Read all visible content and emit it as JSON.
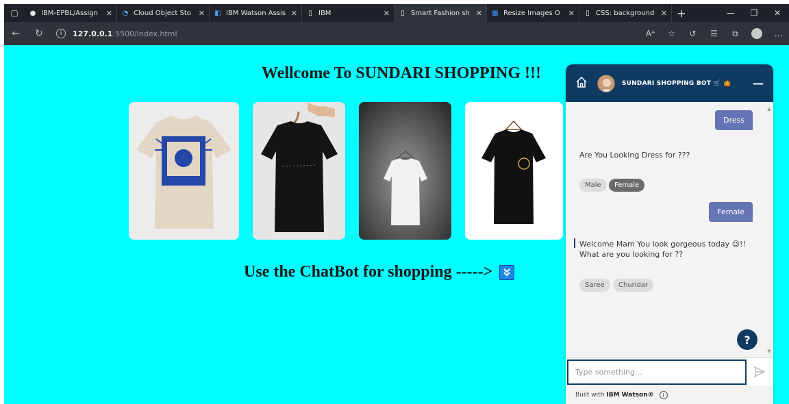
{
  "browser": {
    "tabs": [
      {
        "label": "IBM-EPBL/Assign",
        "icon": "github-icon"
      },
      {
        "label": "Cloud Object Sto",
        "icon": "cloud-icon"
      },
      {
        "label": "IBM Watson Assis",
        "icon": "watson-icon"
      },
      {
        "label": "IBM",
        "icon": "page-icon"
      },
      {
        "label": "Smart Fashion sh",
        "icon": "page-icon",
        "active": true
      },
      {
        "label": "Resize Images O",
        "icon": "image-icon"
      },
      {
        "label": "CSS: background",
        "icon": "page-icon"
      }
    ],
    "url_host": "127.0.0.1",
    "url_path": ":5500/index.html"
  },
  "page": {
    "welcome": "Wellcome To SUNDARI SHOPPING !!!",
    "cta": "Use the ChatBot for shopping ----->",
    "background": "#00ffff"
  },
  "chat": {
    "bot_name": "SUNDARI SHOPPING BOT 🛒 🤷",
    "messages": {
      "user1": "Dress",
      "bot1": "Are You Looking Dress for ???",
      "chip_male": "Male",
      "chip_female": "Female",
      "user2": "Female",
      "bot2_line1": "Welcome Mam You look gorgeous today 😉!!",
      "bot2_line2": "What are you looking for ??",
      "chip_saree": "Saree",
      "chip_churidar": "Churidar"
    },
    "input_placeholder": "Type something...",
    "footer_prefix": "Built with",
    "footer_brand": "IBM Watson®",
    "colors": {
      "header": "#0f3b63",
      "user_bubble": "#6574b4"
    }
  }
}
